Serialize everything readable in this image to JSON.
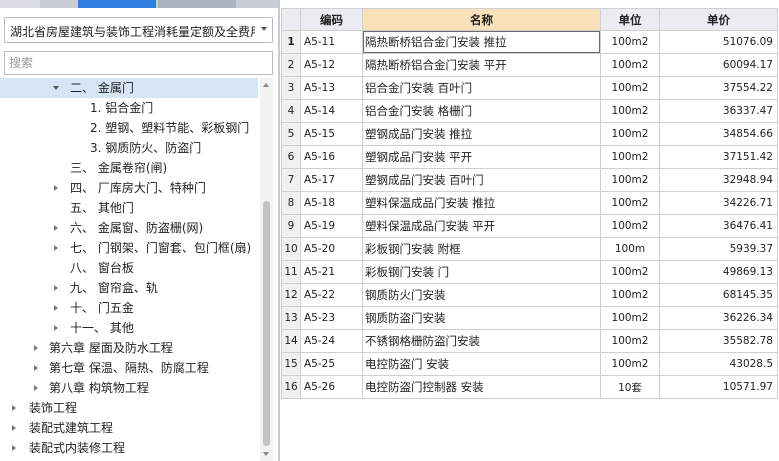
{
  "library_select": {
    "value": "湖北省房屋建筑与装饰工程消耗量定额及全费用基价表"
  },
  "search": {
    "placeholder": "搜索"
  },
  "tree": [
    {
      "label": "二、 金属门",
      "state": "expanded",
      "selected": true
    },
    {
      "label": "1. 铝合金门",
      "state": "leaf"
    },
    {
      "label": "2. 塑钢、塑料节能、彩板钢门",
      "state": "leaf"
    },
    {
      "label": "3. 钢质防火、防盗门",
      "state": "leaf"
    },
    {
      "label": "三、 金属卷帘(闸)",
      "state": "leaf"
    },
    {
      "label": "四、 厂库房大门、特种门",
      "state": "collapsed"
    },
    {
      "label": "五、 其他门",
      "state": "leaf"
    },
    {
      "label": "六、 金属窗、防盗栅(网)",
      "state": "collapsed"
    },
    {
      "label": "七、 门钢架、门窗套、包门框(扇)",
      "state": "collapsed"
    },
    {
      "label": "八、 窗台板",
      "state": "leaf"
    },
    {
      "label": "九、 窗帘盒、轨",
      "state": "collapsed"
    },
    {
      "label": "十、 门五金",
      "state": "collapsed"
    },
    {
      "label": "十一、 其他",
      "state": "collapsed"
    },
    {
      "label": "第六章 屋面及防水工程",
      "state": "collapsed"
    },
    {
      "label": "第七章 保温、隔热、防腐工程",
      "state": "collapsed"
    },
    {
      "label": "第八章 构筑物工程",
      "state": "collapsed"
    },
    {
      "label": "装饰工程",
      "state": "collapsed"
    },
    {
      "label": "装配式建筑工程",
      "state": "collapsed"
    },
    {
      "label": "装配式内装修工程",
      "state": "collapsed"
    }
  ],
  "table": {
    "columns": [
      "",
      "编码",
      "名称",
      "单位",
      "单价"
    ],
    "rows": [
      {
        "idx": "1",
        "code": "A5-11",
        "name": "隔热断桥铝合金门安装 推拉",
        "unit": "100m2",
        "price": "51076.09"
      },
      {
        "idx": "2",
        "code": "A5-12",
        "name": "隔热断桥铝合金门安装 平开",
        "unit": "100m2",
        "price": "60094.17"
      },
      {
        "idx": "3",
        "code": "A5-13",
        "name": "铝合金门安装 百叶门",
        "unit": "100m2",
        "price": "37554.22"
      },
      {
        "idx": "4",
        "code": "A5-14",
        "name": "铝合金门安装 格栅门",
        "unit": "100m2",
        "price": "36337.47"
      },
      {
        "idx": "5",
        "code": "A5-15",
        "name": "塑钢成品门安装 推拉",
        "unit": "100m2",
        "price": "34854.66"
      },
      {
        "idx": "6",
        "code": "A5-16",
        "name": "塑钢成品门安装 平开",
        "unit": "100m2",
        "price": "37151.42"
      },
      {
        "idx": "7",
        "code": "A5-17",
        "name": "塑钢成品门安装 百叶门",
        "unit": "100m2",
        "price": "32948.94"
      },
      {
        "idx": "8",
        "code": "A5-18",
        "name": "塑料保温成品门安装 推拉",
        "unit": "100m2",
        "price": "34226.71"
      },
      {
        "idx": "9",
        "code": "A5-19",
        "name": "塑料保温成品门安装 平开",
        "unit": "100m2",
        "price": "36476.41"
      },
      {
        "idx": "10",
        "code": "A5-20",
        "name": "彩板钢门安装 附框",
        "unit": "100m",
        "price": "5939.37"
      },
      {
        "idx": "11",
        "code": "A5-21",
        "name": "彩板钢门安装 门",
        "unit": "100m2",
        "price": "49869.13"
      },
      {
        "idx": "12",
        "code": "A5-22",
        "name": "钢质防火门安装",
        "unit": "100m2",
        "price": "68145.35"
      },
      {
        "idx": "13",
        "code": "A5-23",
        "name": "钢质防盗门安装",
        "unit": "100m2",
        "price": "36226.34"
      },
      {
        "idx": "14",
        "code": "A5-24",
        "name": "不锈钢格栅防盗门安装",
        "unit": "100m2",
        "price": "35582.78"
      },
      {
        "idx": "15",
        "code": "A5-25",
        "name": "电控防盗门 安装",
        "unit": "100m2",
        "price": "43028.5"
      },
      {
        "idx": "16",
        "code": "A5-26",
        "name": "电控防盗门控制器 安装",
        "unit": "10套",
        "price": "10571.97"
      }
    ]
  }
}
